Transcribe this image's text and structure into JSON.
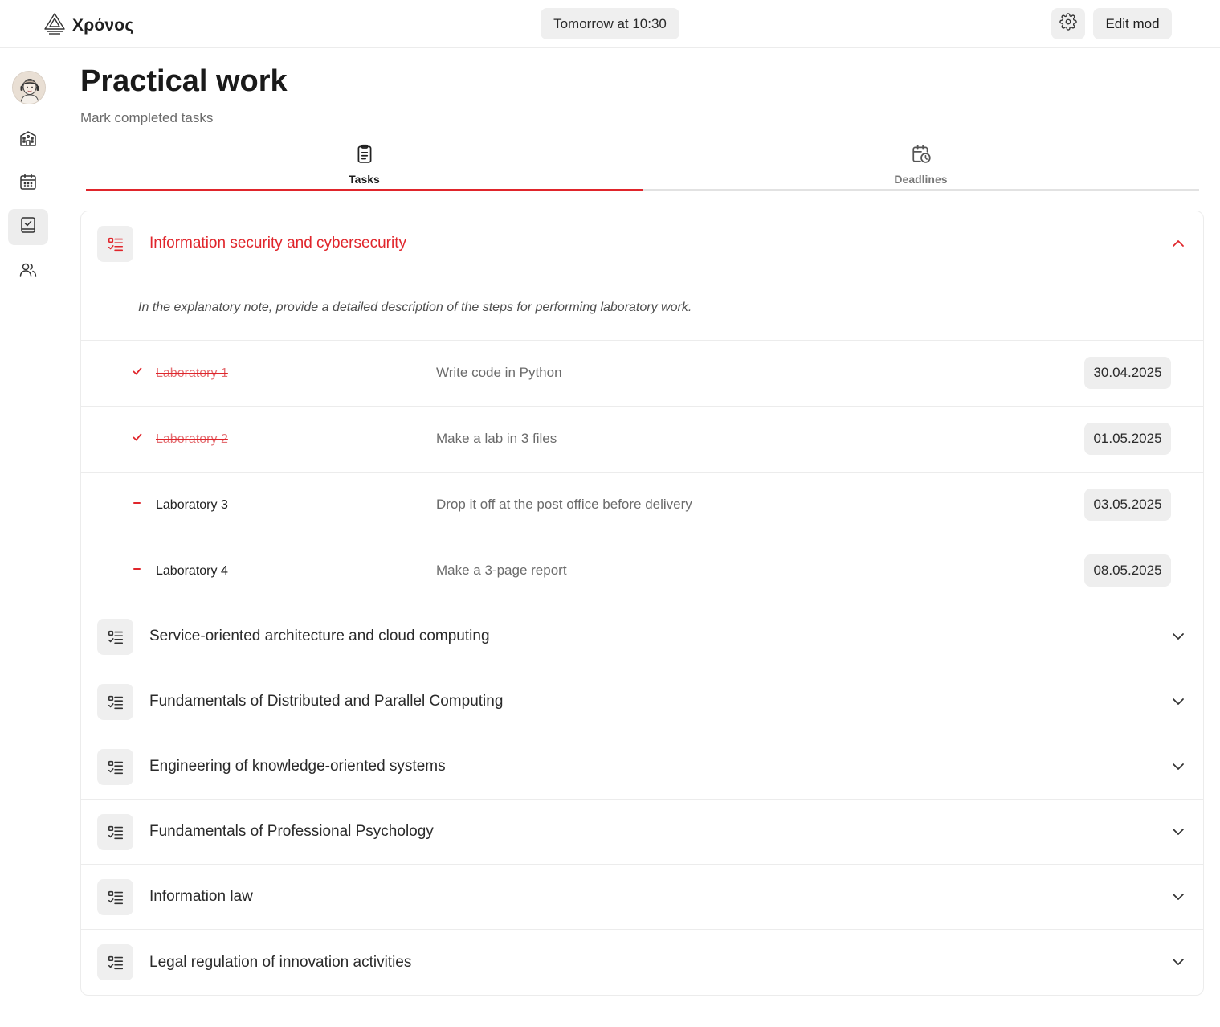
{
  "app": {
    "logo_text": "Χρόνος",
    "next_event": "Tomorrow at 10:30",
    "edit_label": "Edit mod"
  },
  "sidebar": {
    "items": [
      {
        "icon": "building-icon",
        "active": false
      },
      {
        "icon": "calendar-icon",
        "active": false
      },
      {
        "icon": "tasks-icon",
        "active": true
      },
      {
        "icon": "users-icon",
        "active": false
      }
    ]
  },
  "page": {
    "title": "Practical work",
    "subtitle": "Mark completed tasks"
  },
  "tabs": [
    {
      "label": "Tasks",
      "icon": "clipboard-icon",
      "active": true
    },
    {
      "label": "Deadlines",
      "icon": "calendar-clock-icon",
      "active": false
    }
  ],
  "colors": {
    "accent": "#e0252b",
    "done_text": "#e46d71",
    "pill_bg": "#efefef"
  },
  "subjects": [
    {
      "title": "Information security and cybersecurity",
      "open": true,
      "note": "In the explanatory note, provide a detailed description of the steps for performing laboratory work.",
      "tasks": [
        {
          "name": "Laboratory 1",
          "desc": "Write code in Python",
          "date": "30.04.2025",
          "done": true
        },
        {
          "name": "Laboratory 2",
          "desc": "Make a lab in 3 files",
          "date": "01.05.2025",
          "done": true
        },
        {
          "name": "Laboratory 3",
          "desc": "Drop it off at the post office before delivery",
          "date": "03.05.2025",
          "done": false
        },
        {
          "name": "Laboratory 4",
          "desc": "Make a 3-page report",
          "date": "08.05.2025",
          "done": false
        }
      ]
    },
    {
      "title": "Service-oriented architecture and cloud computing",
      "open": false
    },
    {
      "title": "Fundamentals of Distributed and Parallel Computing",
      "open": false
    },
    {
      "title": "Engineering of knowledge-oriented systems",
      "open": false
    },
    {
      "title": "Fundamentals of Professional Psychology",
      "open": false
    },
    {
      "title": "Information law",
      "open": false
    },
    {
      "title": "Legal regulation of innovation activities",
      "open": false
    }
  ]
}
